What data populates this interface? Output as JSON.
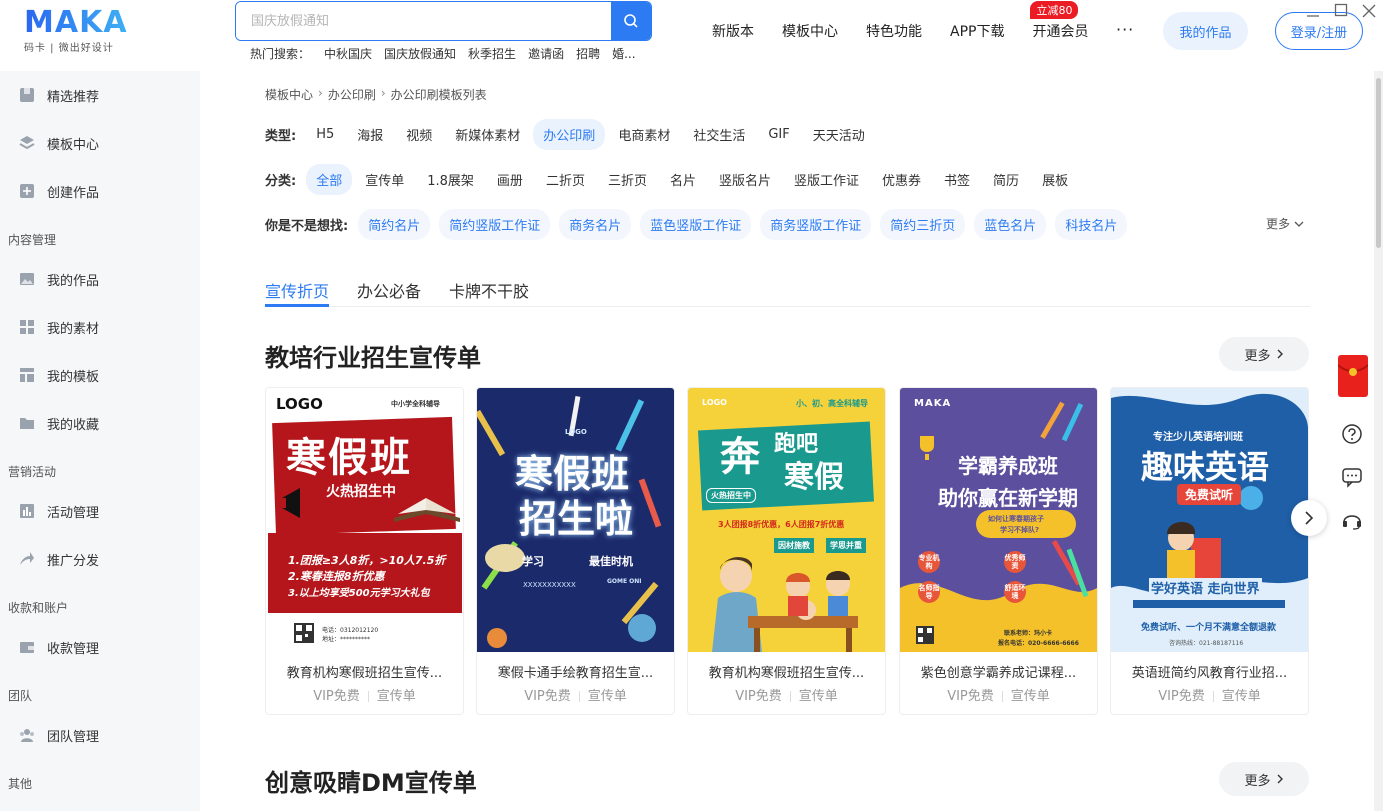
{
  "header": {
    "logo": "MAKA",
    "logo_sub": "码卡 | 微出好设计",
    "search_placeholder": "国庆放假通知",
    "hot_label": "热门搜索：",
    "hot": [
      "中秋国庆",
      "国庆放假通知",
      "秋季招生",
      "邀请函",
      "招聘",
      "婚..."
    ],
    "nav": [
      "新版本",
      "模板中心",
      "特色功能",
      "APP下载",
      "开通会员"
    ],
    "vip_badge": "立减80",
    "more_dots": "···",
    "my_works": "我的作品",
    "login": "登录/注册"
  },
  "sidebar": {
    "items": [
      {
        "label": "精选推荐"
      },
      {
        "label": "模板中心"
      },
      {
        "label": "创建作品"
      }
    ],
    "sec_content": "内容管理",
    "content_items": [
      {
        "label": "我的作品"
      },
      {
        "label": "我的素材"
      },
      {
        "label": "我的模板"
      },
      {
        "label": "我的收藏"
      }
    ],
    "sec_marketing": "营销活动",
    "marketing_items": [
      {
        "label": "活动管理"
      },
      {
        "label": "推广分发"
      }
    ],
    "sec_account": "收款和账户",
    "account_items": [
      {
        "label": "收款管理"
      }
    ],
    "sec_team": "团队",
    "team_items": [
      {
        "label": "团队管理"
      }
    ],
    "sec_other": "其他"
  },
  "breadcrumb": [
    "模板中心",
    "办公印刷",
    "办公印刷模板列表"
  ],
  "filters": {
    "type_label": "类型:",
    "types": [
      "H5",
      "海报",
      "视频",
      "新媒体素材",
      "办公印刷",
      "电商素材",
      "社交生活",
      "GIF",
      "天天活动"
    ],
    "cat_label": "分类:",
    "cats": [
      "全部",
      "宣传单",
      "1.8展架",
      "画册",
      "二折页",
      "三折页",
      "名片",
      "竖版名片",
      "竖版工作证",
      "优惠券",
      "书签",
      "简历",
      "展板"
    ],
    "suggest_label": "你是不是想找:",
    "suggest": [
      "简约名片",
      "简约竖版工作证",
      "商务名片",
      "蓝色竖版工作证",
      "商务竖版工作证",
      "简约三折页",
      "蓝色名片",
      "科技名片"
    ],
    "more": "更多"
  },
  "tabs": [
    "宣传折页",
    "办公必备",
    "卡牌不干胶"
  ],
  "section1": {
    "title": "教培行业招生宣传单",
    "more": "更多",
    "cards": [
      {
        "title": "教育机构寒假班招生宣传...",
        "vip": "VIP免费",
        "cat": "宣传单"
      },
      {
        "title": "寒假卡通手绘教育招生宣...",
        "vip": "VIP免费",
        "cat": "宣传单"
      },
      {
        "title": "教育机构寒假班招生宣传...",
        "vip": "VIP免费",
        "cat": "宣传单"
      },
      {
        "title": "紫色创意学霸养成记课程...",
        "vip": "VIP免费",
        "cat": "宣传单"
      },
      {
        "title": "英语班简约风教育行业招...",
        "vip": "VIP免费",
        "cat": "宣传单"
      }
    ]
  },
  "section2": {
    "title": "创意吸睛DM宣传单",
    "more": "更多"
  },
  "posters": {
    "p1": {
      "logo": "LOGO",
      "tag": "中小学全科辅导",
      "title": "寒假班",
      "sub": "火热招生中",
      "l1": "1.团报≥3人8折，>10人7.5折",
      "l2": "2.寒春连报8折优惠",
      "l3": "3.以上均享受500元学习大礼包",
      "tel": "电话：0312012120",
      "addr": "地址：**********"
    },
    "p2": {
      "logo": "LOGO",
      "title1": "寒假班",
      "title2": "招生啦",
      "btm1": "学习",
      "btm2": "最佳时机",
      "btm3": "XXXXXXXXXXX",
      "btm4": "GOME ONI"
    },
    "p3": {
      "logo": "LOGO",
      "tag": "小、初、高全科辅导",
      "t1": "奔",
      "t2": "跑吧",
      "t3": "寒假",
      "badge": "火热招生中",
      "offer": "3人团报8折优惠，6人团报7折优惠",
      "b1": "因材施教",
      "b2": "学思并重"
    },
    "p4": {
      "logo": "MAKA",
      "t1": "学霸养成班",
      "t2": "助你赢在新学期",
      "bubble1": "如何让寒春期孩子",
      "bubble2": "学习不掉队?",
      "f1": "专业机构",
      "f2": "优秀师资",
      "f3": "名师指导",
      "f4": "舒适环境",
      "contact": "联系老师：玛小卡",
      "tel": "报名电话：020-6666-6666"
    },
    "p5": {
      "tag": "专注少儿英语培训班",
      "title": "趣味英语",
      "free": "免费试听",
      "sub": "学好英语 走向世界",
      "foot": "免费试听、一个月不满意全额退款",
      "tel": "咨询热线：021-88187116"
    }
  },
  "colors": {
    "accent": "#2d7bf2",
    "badge": "#ec1c24"
  }
}
